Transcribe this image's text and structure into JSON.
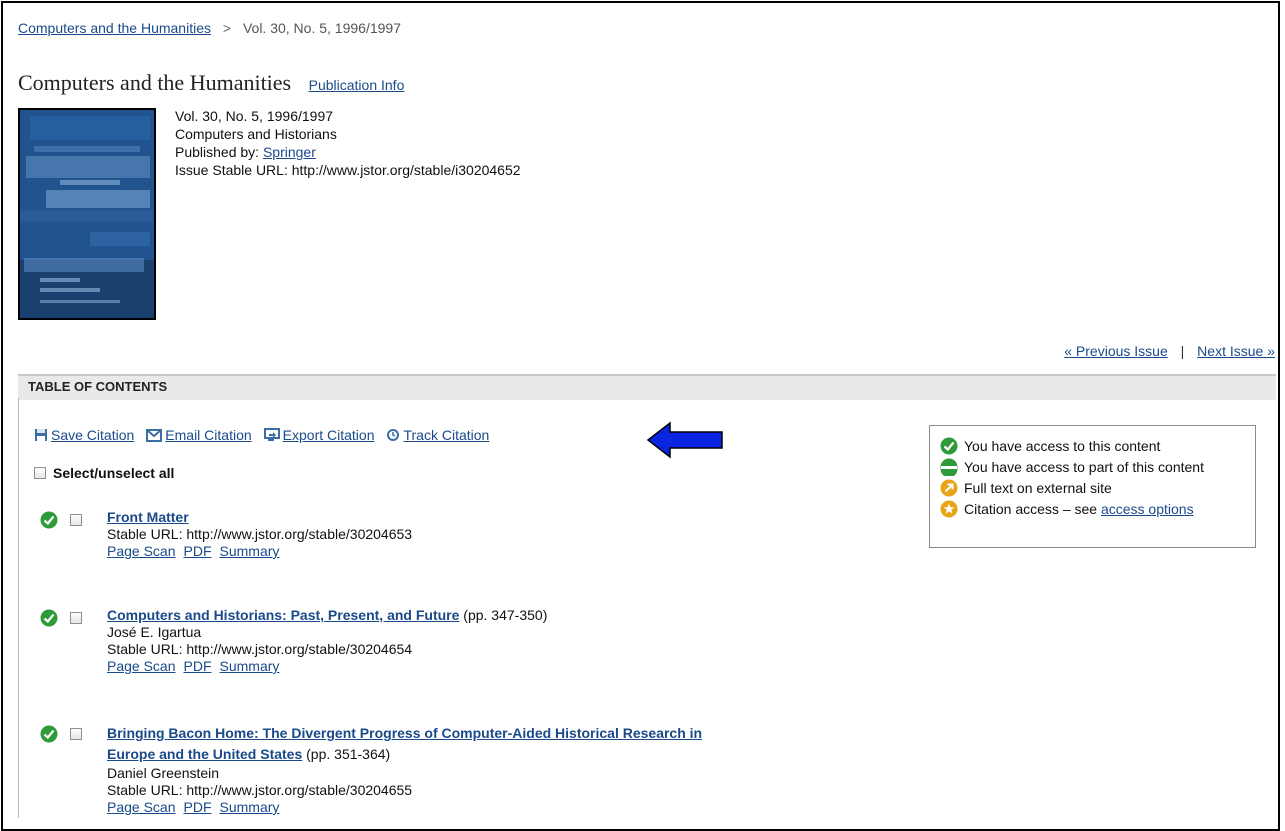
{
  "breadcrumb": {
    "journal_link": "Computers and the Humanities",
    "separator": ">",
    "current": "Vol. 30, No. 5, 1996/1997"
  },
  "journal": {
    "title": "Computers and the Humanities",
    "publication_info_link": "Publication Info"
  },
  "issue": {
    "volume": "Vol. 30, No. 5, 1996/1997",
    "theme": "Computers and Historians",
    "published_by_label": "Published by:",
    "publisher": "Springer",
    "stable_url": "Issue Stable URL: http://www.jstor.org/stable/i30204652"
  },
  "issue_nav": {
    "previous": "« Previous Issue",
    "divider": "|",
    "next": "Next Issue »"
  },
  "toc": {
    "header": "TABLE OF CONTENTS",
    "toolbar": {
      "save": "Save Citation",
      "email": "Email Citation",
      "export": "Export Citation",
      "track": "Track Citation"
    },
    "select_all": "Select/unselect all",
    "articles": [
      {
        "title": "Front Matter",
        "title_line2": "",
        "pages": "",
        "author": "",
        "stable_url": "Stable URL: http://www.jstor.org/stable/30204653",
        "links": [
          "Page Scan",
          "PDF",
          "Summary"
        ]
      },
      {
        "title": "Computers and Historians: Past, Present, and Future",
        "title_line2": "",
        "pages": "(pp. 347-350)",
        "author": "José E. Igartua",
        "stable_url": "Stable URL: http://www.jstor.org/stable/30204654",
        "links": [
          "Page Scan",
          "PDF",
          "Summary"
        ]
      },
      {
        "title": "Bringing Bacon Home: The Divergent Progress of Computer-Aided Historical Research in",
        "title_line2": "Europe and the United States",
        "pages": "(pp. 351-364)",
        "author": "Daniel Greenstein",
        "stable_url": "Stable URL: http://www.jstor.org/stable/30204655",
        "links": [
          "Page Scan",
          "PDF",
          "Summary"
        ]
      }
    ]
  },
  "legend": {
    "full_access": "You have access to this content",
    "partial_access": "You have access to part of this content",
    "external": "Full text on external site",
    "citation_prefix": "Citation access – see",
    "citation_link": "access options"
  },
  "colors": {
    "link": "#1a4a8a",
    "access_green": "#2e9a3a",
    "external_gold": "#e8a317",
    "arrow_blue": "#0a24e0"
  }
}
